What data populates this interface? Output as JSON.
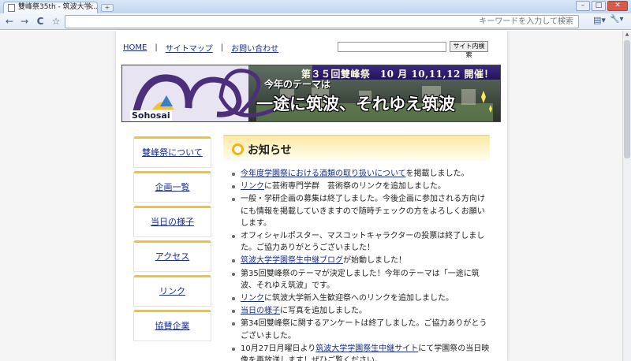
{
  "browser": {
    "tab_title": "雙峰祭35th - 筑波大学...",
    "new_tab": "+",
    "window": {
      "minimize": "–",
      "maximize": "□",
      "close": "✕"
    },
    "nav": {
      "back": "←",
      "forward": "→",
      "reload": "C",
      "star": "☆"
    },
    "omnibox_placeholder": "キーワードを入力して検索",
    "page_menu": "▤▾",
    "wrench_menu": "🔧▾"
  },
  "topnav": {
    "items": [
      "HOME",
      "サイトマップ",
      "お問い合わせ"
    ],
    "separator": "|"
  },
  "site_search": {
    "value": "",
    "button": "サイト内検索"
  },
  "banner": {
    "announce": "第３５回雙峰祭　10 月 10,11,12 開催！",
    "theme_label": "今年のテーマは",
    "theme": "一途に筑波、それゆえ筑波",
    "logo_text": "Sohosai"
  },
  "sidenav": {
    "items": [
      "雙峰祭について",
      "企画一覧",
      "当日の様子",
      "アクセス",
      "リンク",
      "協賛企業"
    ]
  },
  "news": {
    "title": "お知らせ",
    "items": [
      {
        "link": "今年度学園祭における酒類の取り扱いについて",
        "text": "を掲載しました。"
      },
      {
        "link": "リンク",
        "text": "に芸術専門学群　芸術祭のリンクを追加しました。"
      },
      {
        "link": "",
        "text": "一般・学研企画の募集は終了しました。今後企画に参加される方向けにも情報を掲載していきますので随時チェックの方をよろしくお願いします。"
      },
      {
        "link": "",
        "text": "オフィシャルポスター、マスコットキャラクターの投票は終了しました。ご協力ありがとうございました！"
      },
      {
        "link": "筑波大学学園祭生中継ブログ",
        "text": "が始動しました！"
      },
      {
        "link": "",
        "text": "第35回雙峰祭のテーマが決定しました！今年のテーマは「一途に筑波、それゆえ筑波」です。"
      },
      {
        "link": "リンク",
        "text": "に筑波大学新入生歓迎祭へのリンクを追加しました。"
      },
      {
        "link": "当日の様子",
        "text": "に写真を追加しました。"
      },
      {
        "link": "",
        "text": "第34回雙峰祭に関するアンケートは終了しました。ご協力ありがとうございました。"
      },
      {
        "link": "筑波大学学園祭生中継サイト",
        "prefix": "10月27日月曜日より",
        "text": "にて学園祭の当日映像を再放送します！ぜひご覧ください。"
      }
    ]
  }
}
